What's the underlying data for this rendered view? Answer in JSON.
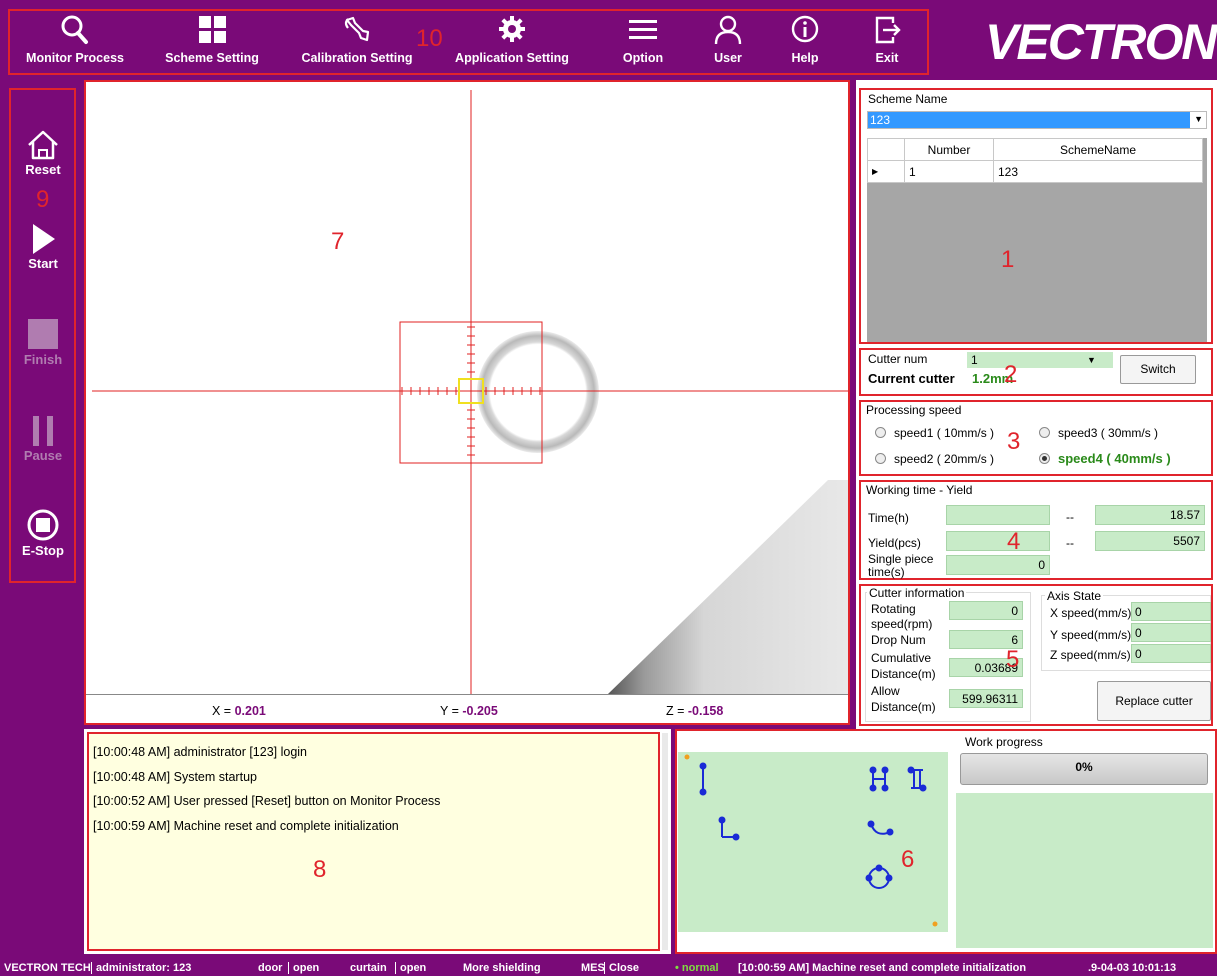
{
  "toolbar": {
    "items": [
      {
        "label": "Monitor Process",
        "icon": "search-icon"
      },
      {
        "label": "Scheme Setting",
        "icon": "grid-icon"
      },
      {
        "label": "Calibration Setting",
        "icon": "wrench-icon"
      },
      {
        "label": "Application Setting",
        "icon": "gear-icon"
      },
      {
        "label": "Option",
        "icon": "menu-icon"
      },
      {
        "label": "User",
        "icon": "user-icon"
      },
      {
        "label": "Help",
        "icon": "info-icon"
      },
      {
        "label": "Exit",
        "icon": "exit-icon"
      }
    ],
    "logo": "VECTRON"
  },
  "sidebar": {
    "items": [
      {
        "label": "Reset",
        "icon": "home-icon",
        "enabled": true
      },
      {
        "label": "Start",
        "icon": "play-icon",
        "enabled": true
      },
      {
        "label": "Finish",
        "icon": "stop-square-icon",
        "enabled": false
      },
      {
        "label": "Pause",
        "icon": "pause-icon",
        "enabled": false
      },
      {
        "label": "E-Stop",
        "icon": "emergency-stop-icon",
        "enabled": true
      }
    ]
  },
  "annotations": [
    "1",
    "2",
    "3",
    "4",
    "5",
    "6",
    "7",
    "8",
    "9",
    "10"
  ],
  "camera": {
    "x_label": "X = ",
    "x_value": "0.201",
    "y_label": "Y = ",
    "y_value": "-0.205",
    "z_label": "Z = ",
    "z_value": "-0.158"
  },
  "scheme": {
    "title": "Scheme Name",
    "selected": "123",
    "columns": [
      "Number",
      "SchemeName"
    ],
    "rows": [
      [
        "1",
        "123"
      ]
    ]
  },
  "cutter": {
    "num_label": "Cutter num",
    "num_value": "1",
    "current_label": "Current cutter",
    "current_value": "1.2mm",
    "switch_label": "Switch"
  },
  "speed": {
    "title": "Processing speed",
    "options": [
      {
        "label": "speed1 ( 10mm/s )",
        "selected": false
      },
      {
        "label": "speed3 ( 30mm/s )",
        "selected": false
      },
      {
        "label": "speed2 ( 20mm/s )",
        "selected": false
      },
      {
        "label": "speed4 ( 40mm/s )",
        "selected": true
      }
    ]
  },
  "working": {
    "title": "Working time - Yield",
    "time_label": "Time(h)",
    "time_value": "18.57",
    "yield_label": "Yield(pcs)",
    "yield_value": "5507",
    "dash": "--",
    "single_label": "Single piece time(s)",
    "single_value": "0"
  },
  "cutter_info": {
    "title": "Cutter information",
    "rot_label": "Rotating speed(rpm)",
    "rot_value": "0",
    "drop_label": "Drop Num",
    "drop_value": "6",
    "cum_label": "Cumulative Distance(m)",
    "cum_value": "0.03689",
    "allow_label": "Allow Distance(m)",
    "allow_value": "599.96311"
  },
  "axis": {
    "title": "Axis State",
    "x_label": "X speed(mm/s)",
    "x_value": "0",
    "y_label": "Y speed(mm/s)",
    "y_value": "0",
    "z_label": "Z speed(mm/s)",
    "z_value": "0",
    "replace_label": "Replace cutter"
  },
  "log": {
    "lines": [
      "[10:00:48 AM] administrator [123] login",
      "[10:00:48 AM] System startup",
      "[10:00:52 AM] User pressed [Reset] button on Monitor Process",
      "[10:00:59 AM] Machine reset and complete initialization"
    ]
  },
  "progress": {
    "title": "Work progress",
    "value_text": "0%",
    "fraction": 0
  },
  "status": {
    "brand": "VECTRON TECH",
    "user": "administrator: 123",
    "door_label": "door",
    "door_value": "open",
    "curtain_label": "curtain",
    "curtain_value": "open",
    "shield": "More shielding",
    "mes_label": "MES",
    "mes_value": "Close",
    "state": "• normal",
    "message": "[10:00:59 AM] Machine reset and complete initialization",
    "datetime": ".9-04-03  10:01:13"
  },
  "colors": {
    "brand_purple": "#7a0a78",
    "annotation_red": "#e0242c",
    "panel_green": "#c8ebc8",
    "selected_blue": "#3399ff",
    "log_bg": "#ffffe0"
  }
}
